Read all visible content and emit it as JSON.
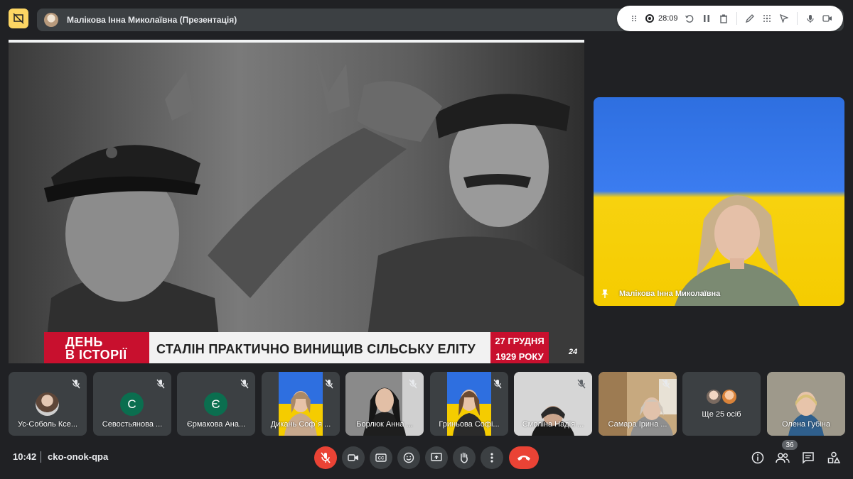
{
  "header": {
    "presenter_title": "Малікова Інна Миколаївна (Презентація)"
  },
  "recording": {
    "time": "28:09"
  },
  "slide": {
    "banner_left_line1": "ДЕНЬ",
    "banner_left_line2": "В ІСТОРІЇ",
    "banner_text": "СТАЛІН ПРАКТИЧНО ВИНИЩИВ СІЛЬСЬКУ ЕЛІТУ",
    "date_line1": "27 ГРУДНЯ",
    "date_line2": "1929 РОКУ",
    "channel_logo": "24"
  },
  "main_tile": {
    "name": "Малікова Інна Миколаївна"
  },
  "participants": [
    {
      "name": "Ус-Соболь Ксе...",
      "avatar": "photo",
      "color": "#5f6368"
    },
    {
      "name": "Севостьянова ...",
      "avatar": "С",
      "color": "#0b6e4f"
    },
    {
      "name": "Єрмакова Ана...",
      "avatar": "Є",
      "color": "#0b6e4f"
    },
    {
      "name": "Дикань Соф`я ...",
      "avatar": "video",
      "color": "#3c4043"
    },
    {
      "name": "Борлюк Анна ...",
      "avatar": "video",
      "color": "#3c4043"
    },
    {
      "name": "Гриньова Софі...",
      "avatar": "video",
      "color": "#3c4043"
    },
    {
      "name": "Смоліна Надія ...",
      "avatar": "video",
      "color": "#3c4043"
    },
    {
      "name": "Самара Ірина ...",
      "avatar": "video",
      "color": "#3c4043"
    },
    {
      "name": "Ще 25 осіб",
      "avatar": "group",
      "color": "#3c4043"
    },
    {
      "name": "Олена Губіна",
      "avatar": "video",
      "color": "#3c4043"
    }
  ],
  "footer": {
    "time": "10:42",
    "meeting_code": "cko-onok-qpa",
    "people_count": "36"
  }
}
